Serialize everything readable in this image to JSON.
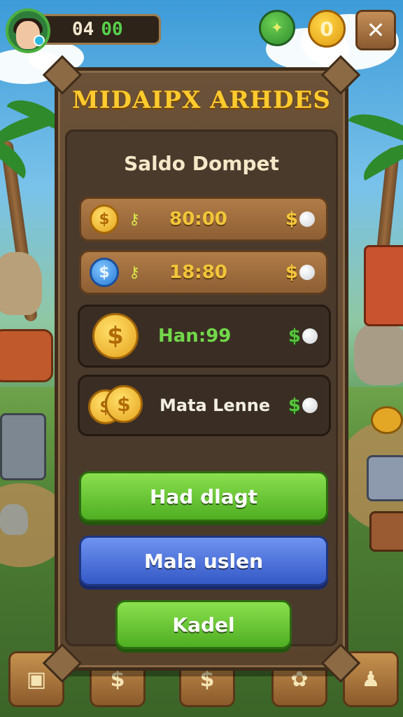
{
  "hud": {
    "score_primary": "04",
    "score_secondary": "00",
    "coin_glyph": "0",
    "close_glyph": "✕"
  },
  "panel": {
    "title": "MIDAIPX ARHDES",
    "subtitle": "Saldo Dompet"
  },
  "rows": [
    {
      "icon": "gold-coin-icon",
      "value": "80:00",
      "currency": "$"
    },
    {
      "icon": "blue-coin-icon",
      "value": "18:80",
      "currency": "$"
    },
    {
      "icon": "gold-coin-icon",
      "label": "Han:99",
      "currency": "$"
    },
    {
      "icon": "coin-stack-icon",
      "label": "Mata Lenne",
      "currency": "$"
    }
  ],
  "buttons": {
    "primary": "Had dlagt",
    "secondary": "Mala uslen",
    "tertiary": "Kadel"
  },
  "colors": {
    "title_gold": "#ffcb2e",
    "green_button": "#5fc02a",
    "blue_button": "#4469d6",
    "panel_wood": "#6a5138"
  },
  "icons": {
    "gems": "gems-icon",
    "coin": "coin-icon",
    "close": "close-icon",
    "nav": [
      "box-icon",
      "coin-icon",
      "coin-icon",
      "paw-icon",
      "profile-icon"
    ]
  }
}
